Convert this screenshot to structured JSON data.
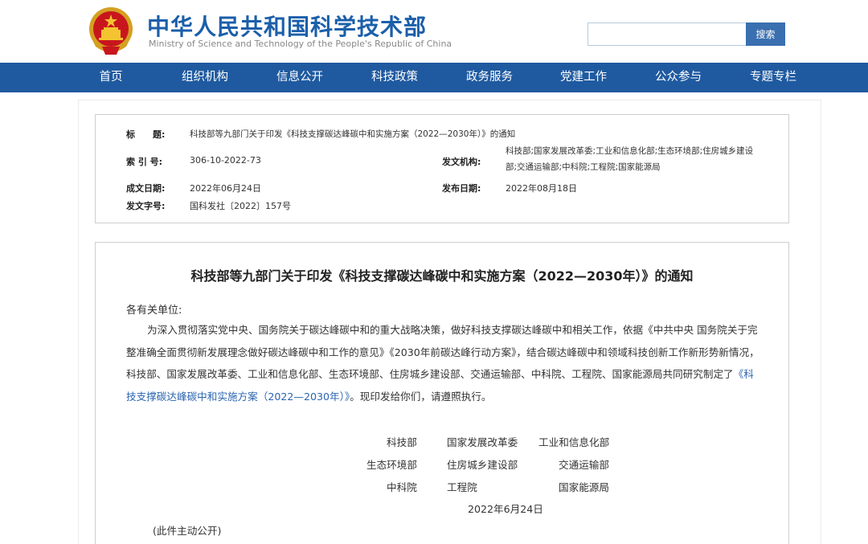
{
  "header": {
    "title": "中华人民共和国科学技术部",
    "subtitle": "Ministry of Science and Technology of the People's Republic of China",
    "emblem_icon": "national-emblem-icon",
    "search_placeholder": "",
    "search_label": "搜索"
  },
  "nav": {
    "items": [
      {
        "label": "首页"
      },
      {
        "label": "组织机构"
      },
      {
        "label": "信息公开"
      },
      {
        "label": "科技政策"
      },
      {
        "label": "政务服务"
      },
      {
        "label": "党建工作"
      },
      {
        "label": "公众参与"
      },
      {
        "label": "专题专栏"
      }
    ]
  },
  "meta": {
    "title_label": "标　　题:",
    "title_value": "科技部等九部门关于印发《科技支撑碳达峰碳中和实施方案（2022—2030年）》的通知",
    "index_label": "索 引 号:",
    "index_value": "306-10-2022-73",
    "issuer_label": "发文机构:",
    "issuer_value": "科技部;国家发展改革委;工业和信息化部;生态环境部;住房城乡建设部;交通运输部;中科院;工程院;国家能源局",
    "written_label": "成文日期:",
    "written_value": "2022年06月24日",
    "published_label": "发布日期:",
    "published_value": "2022年08月18日",
    "doc_no_label": "发文字号:",
    "doc_no_value": "国科发社〔2022〕157号"
  },
  "article": {
    "title": "科技部等九部门关于印发《科技支撑碳达峰碳中和实施方案（2022—2030年）》的通知",
    "salutation": "各有关单位:",
    "body_text": "为深入贯彻落实党中央、国务院关于碳达峰碳中和的重大战略决策，做好科技支撑碳达峰碳中和相关工作，依据《中共中央 国务院关于完整准确全面贯彻新发展理念做好碳达峰碳中和工作的意见》《2030年前碳达峰行动方案》，结合碳达峰碳中和领域科技创新工作新形势新情况，科技部、国家发展改革委、工业和信息化部、生态环境部、住房城乡建设部、交通运输部、中科院、工程院、国家能源局共同研究制定了",
    "body_link": "《科技支撑碳达峰碳中和实施方案（2022—2030年）》",
    "body_tail": "。现印发给你们，请遵照执行。",
    "issuers": [
      "科技部",
      "国家发展改革委",
      "工业和信息化部",
      "生态环境部",
      "住房城乡建设部",
      "交通运输部",
      "中科院",
      "工程院",
      "国家能源局"
    ],
    "date": "2022年6月24日",
    "public_note": "(此件主动公开)"
  },
  "colors": {
    "nav_bg": "#1f5aa0",
    "title_blue": "#1b5faa",
    "link": "#2a64b0"
  }
}
